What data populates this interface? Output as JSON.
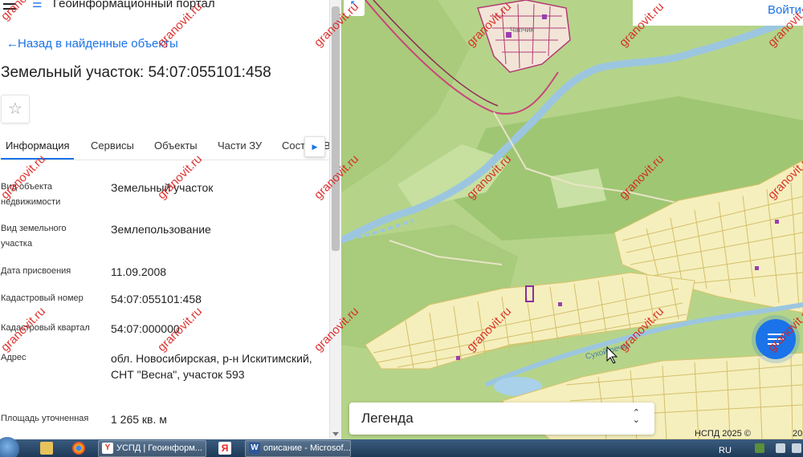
{
  "app": {
    "portal_title": "Геоинформационный портал",
    "back_label": "Назад в найденные объекты",
    "object_title": "Земельный участок: 54:07:055101:458"
  },
  "tabs": [
    {
      "label": "Информация"
    },
    {
      "label": "Сервисы"
    },
    {
      "label": "Объекты"
    },
    {
      "label": "Части ЗУ"
    },
    {
      "label": "Сост"
    },
    {
      "label": "В"
    }
  ],
  "properties": [
    {
      "label": "Вид объекта недвижимости",
      "value": "Земельный участок"
    },
    {
      "label": "Вид земельного участка",
      "value": "Землепользование"
    },
    {
      "label": "Дата присвоения",
      "value": "11.09.2008"
    },
    {
      "label": "Кадастровый номер",
      "value": "54:07:055101:458"
    },
    {
      "label": "Кадастровый квартал",
      "value": "54:07:000000"
    },
    {
      "label": "Адрес",
      "value": "обл. Новосибирская, р-н Искитимский, СНТ \"Весна\", участок 593"
    },
    {
      "label": "Площадь уточненная",
      "value": "1 265 кв. м"
    }
  ],
  "map": {
    "login_label": "Войти",
    "legend_label": "Легенда",
    "copyright": "НСПД 2025 ©",
    "copyright_tail": "20",
    "river_label": "Сухой речка",
    "village_label": "Чапчик"
  },
  "watermark": "granovit.ru",
  "taskbar": {
    "items": [
      {
        "label": "УСПД | Геоинформ..."
      },
      {
        "label": "описание - Microsof..."
      }
    ],
    "lang": "RU"
  },
  "colors": {
    "accent": "#1a73e8",
    "map_green": "#b7d48c",
    "parcel_yellow": "#f5efbd",
    "watermark_red": "#d9201c"
  }
}
